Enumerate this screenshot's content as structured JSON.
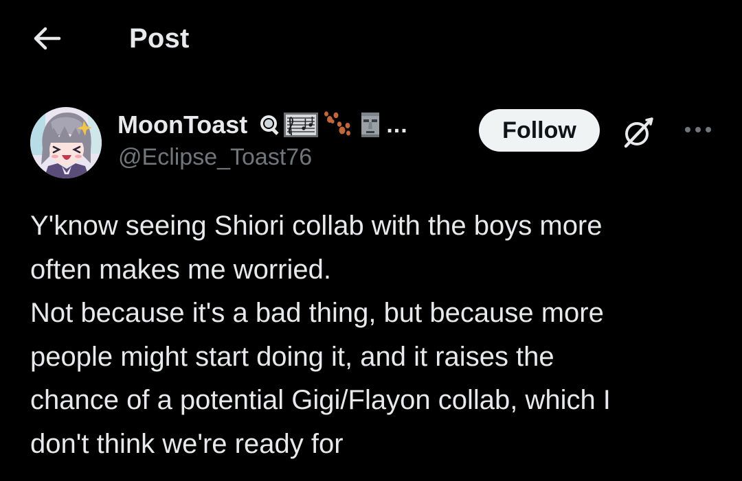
{
  "header": {
    "back_icon": "arrow-left-icon",
    "title": "Post"
  },
  "author": {
    "avatar_icon": "anime-character-avatar",
    "display_name": "MoonToast",
    "name_emojis": [
      "magnifying-glass-emoji",
      "sheet-music-emoji",
      "paw-prints-emoji",
      "moai-emoji"
    ],
    "truncation": "...",
    "handle": "@Eclipse_Toast76"
  },
  "actions": {
    "follow_label": "Follow",
    "grok_icon": "grok-icon",
    "more_icon": "more-horizontal-icon"
  },
  "post": {
    "lines": [
      "Y'know seeing Shiori collab with the boys more",
      "often makes me worried.",
      "Not because it's a bad thing, but because more",
      "people might start doing it, and it raises the",
      "chance of a potential Gigi/Flayon collab, which I",
      "don't think we're ready for"
    ]
  },
  "colors": {
    "background": "#000000",
    "text_primary": "#e7e9ea",
    "text_secondary": "#71767b",
    "follow_bg": "#eff3f4",
    "follow_text": "#0f1419"
  }
}
